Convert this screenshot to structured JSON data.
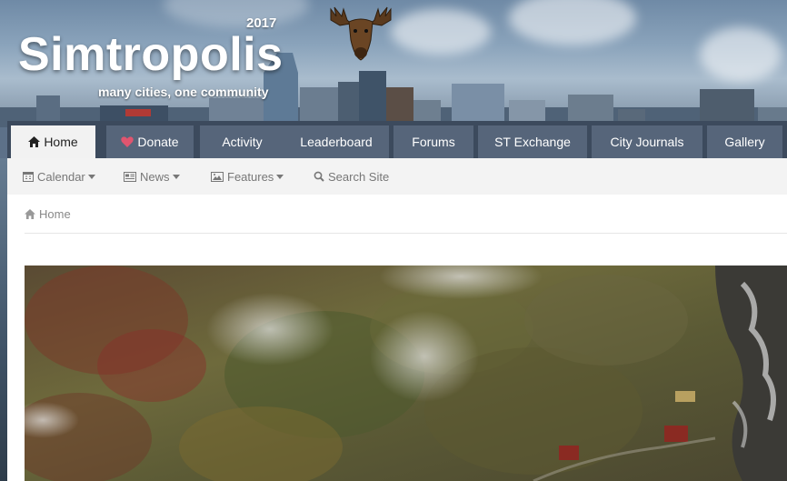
{
  "header": {
    "logo_year": "2017",
    "logo_title": "Simtropolis",
    "tagline": "many cities, one community"
  },
  "main_nav": [
    {
      "label": "Home",
      "icon": "home-icon",
      "active": true
    },
    {
      "label": "Donate",
      "icon": "heart-icon",
      "active": false
    },
    {
      "label": "Activity",
      "active": false
    },
    {
      "label": "Leaderboard",
      "active": false
    },
    {
      "label": "Forums",
      "active": false
    },
    {
      "label": "ST Exchange",
      "active": false
    },
    {
      "label": "City Journals",
      "active": false
    },
    {
      "label": "Gallery",
      "active": false
    }
  ],
  "sub_nav": [
    {
      "label": "Calendar",
      "icon": "calendar-icon",
      "dropdown": true
    },
    {
      "label": "News",
      "icon": "newspaper-icon",
      "dropdown": true
    },
    {
      "label": "Features",
      "icon": "image-icon",
      "dropdown": true
    },
    {
      "label": "Search Site",
      "icon": "search-icon",
      "dropdown": false
    }
  ],
  "breadcrumb": {
    "label": "Home",
    "icon": "home-icon"
  },
  "colors": {
    "nav_bg": "#3c4a5d",
    "tab_bg": "#56657a",
    "tab_active_bg": "#f2f2f2",
    "heart": "#e0556f",
    "subnav_bg": "#f3f3f3"
  }
}
